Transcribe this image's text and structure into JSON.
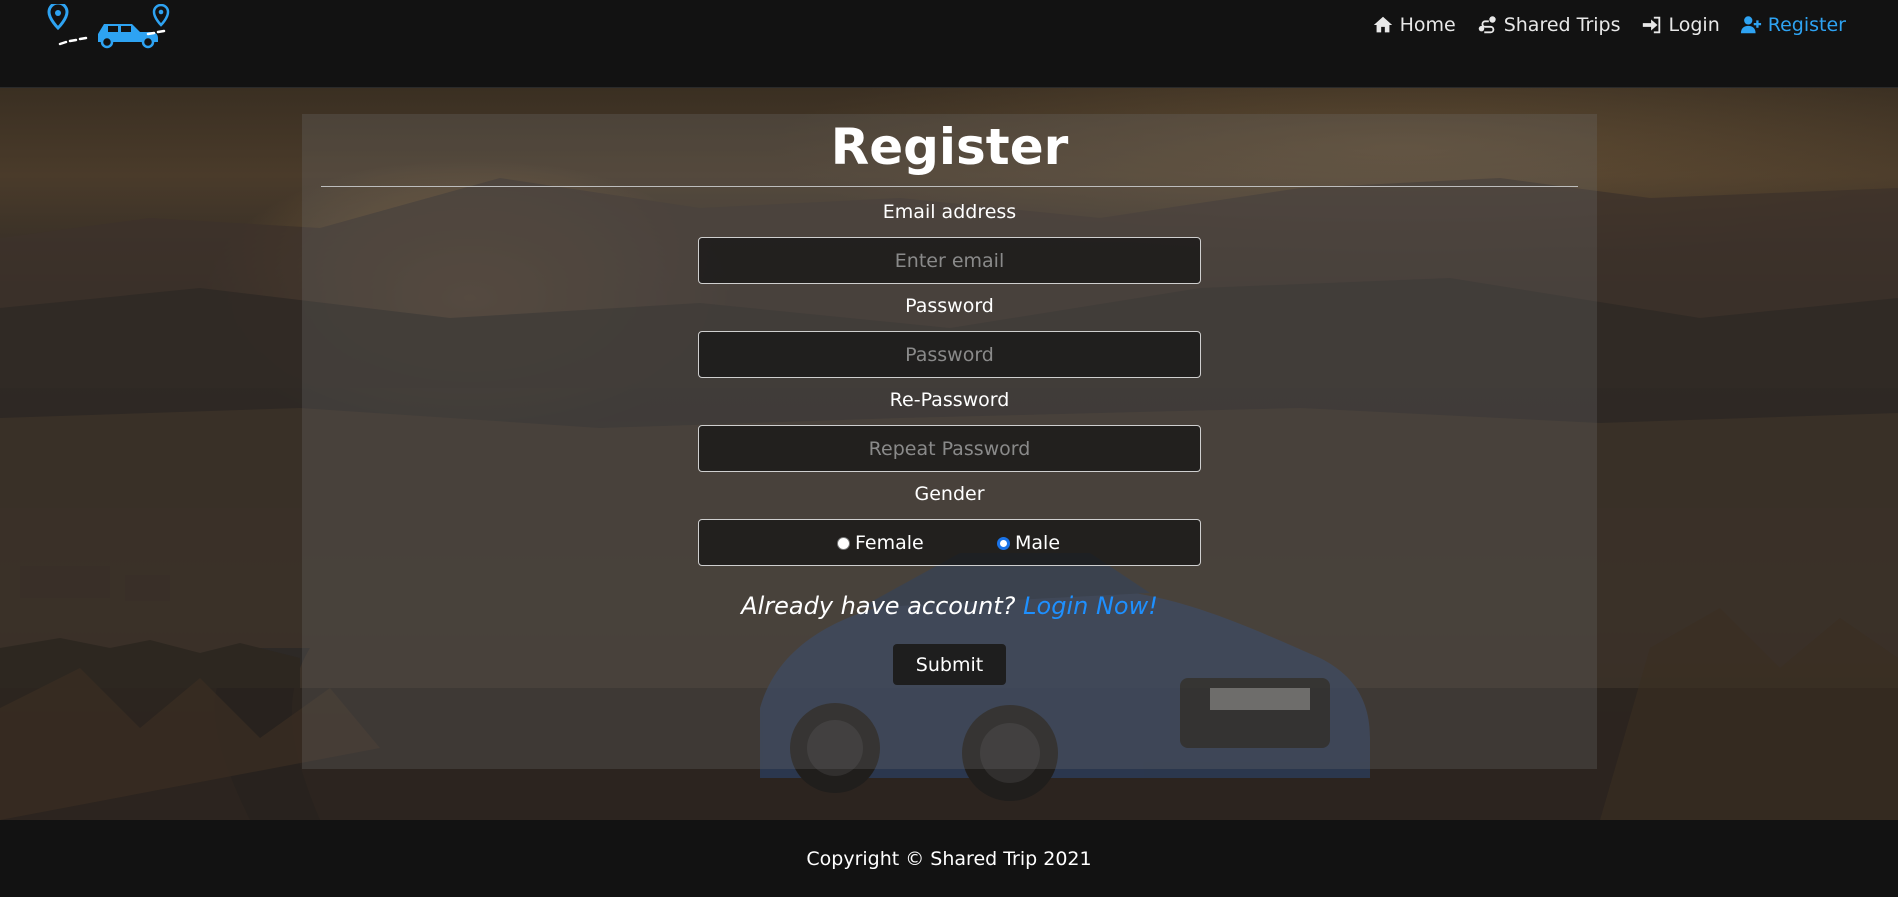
{
  "nav": {
    "items": [
      {
        "label": "Home",
        "icon": "home-icon",
        "active": false
      },
      {
        "label": "Shared Trips",
        "icon": "route-icon",
        "active": false
      },
      {
        "label": "Login",
        "icon": "sign-in-icon",
        "active": false
      },
      {
        "label": "Register",
        "icon": "user-plus-icon",
        "active": true
      }
    ],
    "accent_color": "#2ea3f2"
  },
  "form": {
    "title": "Register",
    "email": {
      "label": "Email address",
      "placeholder": "Enter email",
      "value": ""
    },
    "password": {
      "label": "Password",
      "placeholder": "Password",
      "value": ""
    },
    "repassword": {
      "label": "Re-Password",
      "placeholder": "Repeat Password",
      "value": ""
    },
    "gender": {
      "label": "Gender",
      "options": [
        {
          "label": "Female",
          "checked": false
        },
        {
          "label": "Male",
          "checked": true
        }
      ]
    },
    "account_prompt": "Already have account?",
    "login_link": "Login Now!",
    "submit_label": "Submit"
  },
  "footer": {
    "copyright": "Copyright © Shared Trip 2021"
  }
}
